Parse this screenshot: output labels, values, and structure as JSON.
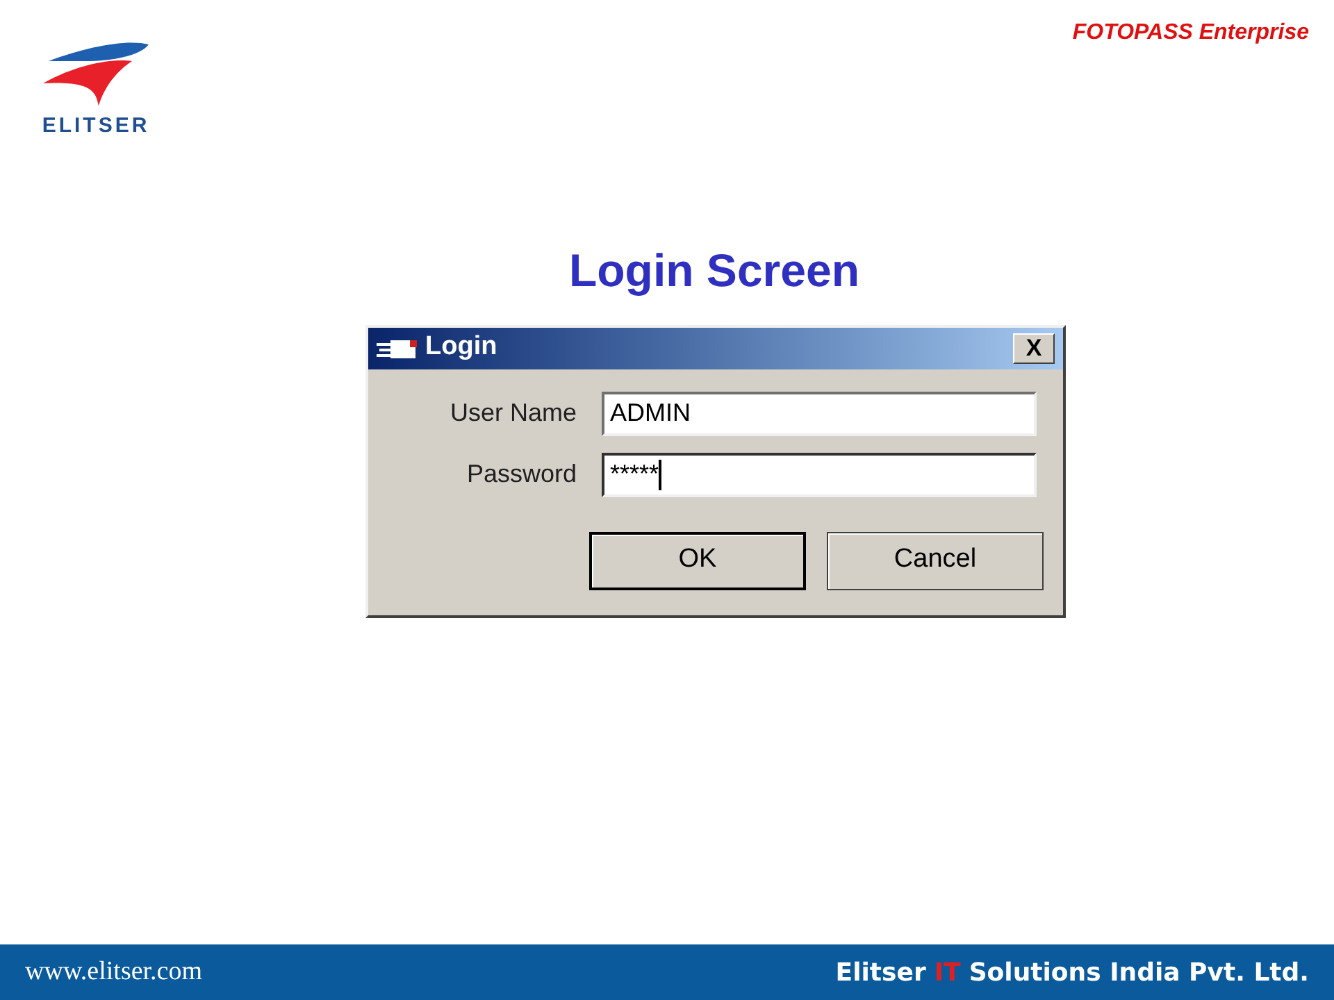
{
  "header": {
    "logo_text": "ELITSER",
    "product": "FOTOPASS Enterprise"
  },
  "title": "Login Screen",
  "dialog": {
    "title": "Login",
    "close": "X",
    "fields": [
      {
        "label": "User Name",
        "value": "ADMIN",
        "focused": false
      },
      {
        "label": "Password",
        "value": "*****",
        "focused": true
      }
    ],
    "buttons": [
      {
        "label": "OK",
        "default": true
      },
      {
        "label": "Cancel",
        "default": false
      }
    ]
  },
  "footer": {
    "url": "www.elitser.com",
    "company": [
      {
        "text": "Elitser",
        "color": "#ffffff"
      },
      {
        "text": "IT",
        "color": "#e02020"
      },
      {
        "text": "Solutions India Pvt. Ltd.",
        "color": "#ffffff"
      }
    ]
  }
}
